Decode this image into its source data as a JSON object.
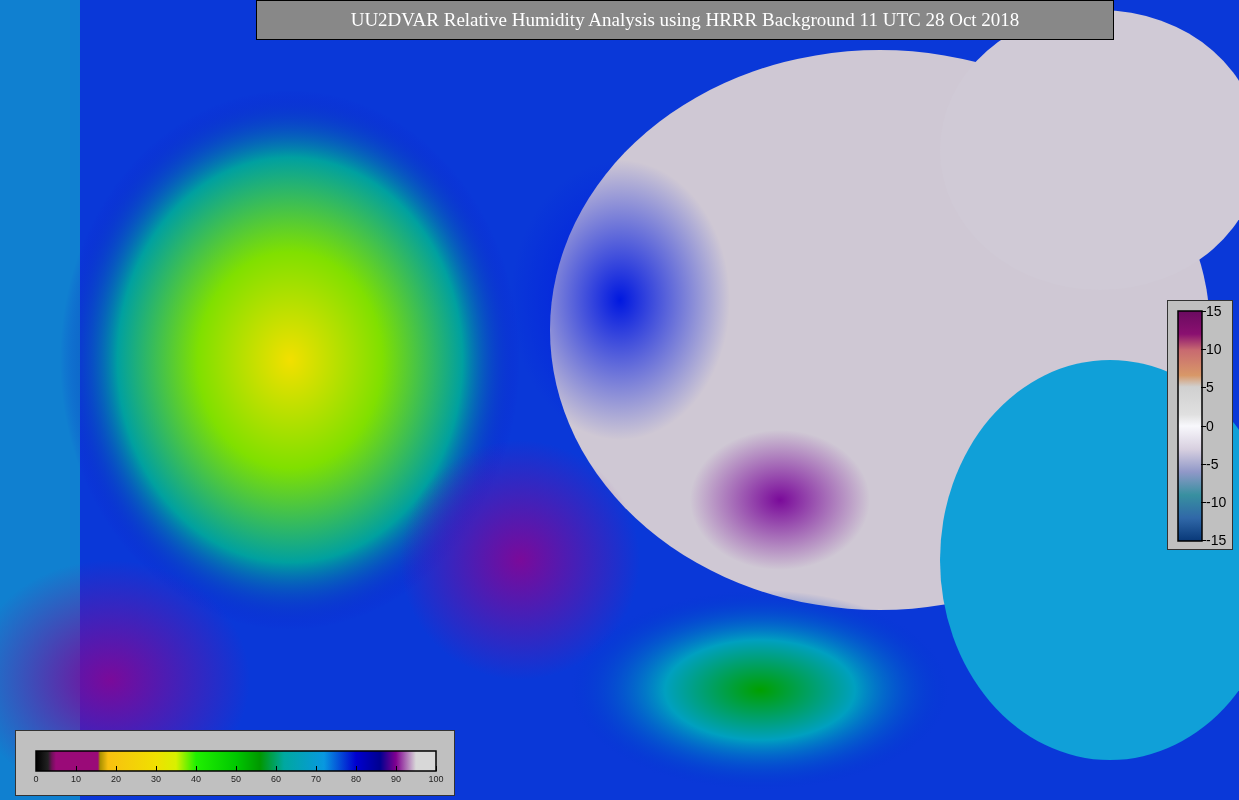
{
  "title": "UU2DVAR Relative Humidity Analysis using HRRR Background 11 UTC 28 Oct 2018",
  "humidity_colorbar": {
    "ticks": [
      "0",
      "10",
      "20",
      "30",
      "40",
      "50",
      "60",
      "70",
      "80",
      "90",
      "100"
    ]
  },
  "difference_colorbar": {
    "ticks": [
      "15",
      "10",
      "5",
      "0",
      "-5",
      "-10",
      "-15"
    ]
  }
}
